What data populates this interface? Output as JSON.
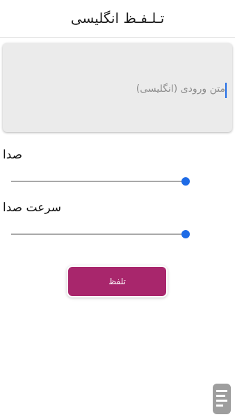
{
  "app_bar": {
    "title": "تـلـفـظ انگلیسی"
  },
  "text_input": {
    "value": "",
    "placeholder": "متن ورودی (انگلیسی)"
  },
  "sliders": [
    {
      "label": "صدا",
      "value": 1.0,
      "min": 0,
      "max": 1
    },
    {
      "label": "سرعت صدا",
      "value": 1.0,
      "min": 0,
      "max": 1
    }
  ],
  "pronounce_button": {
    "label": "تلفظ"
  },
  "colors": {
    "accent": "#1e6be6",
    "button": "#a8266c",
    "input_background": "#ebebeb"
  },
  "logo": {
    "icon": "brand-logo-icon"
  }
}
